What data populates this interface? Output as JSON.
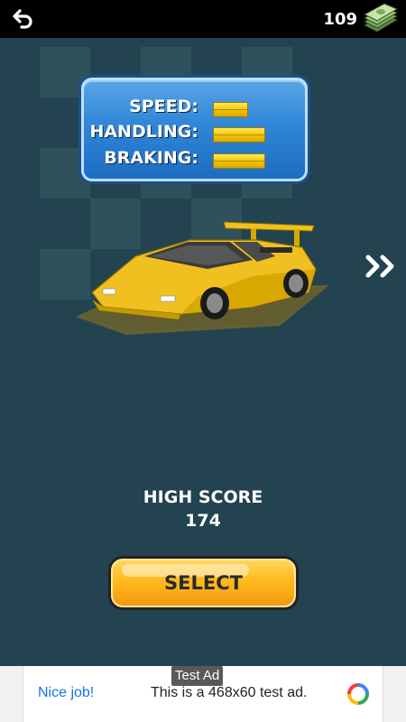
{
  "topbar": {
    "back_icon": "undo-arrow-icon",
    "money_count": "109",
    "cash_icon": "cash-stack-icon"
  },
  "stats": {
    "rows": [
      {
        "label": "SPEED:",
        "fill": 0.32
      },
      {
        "label": "HANDLING:",
        "fill": 0.48
      },
      {
        "label": "BRAKING:",
        "fill": 0.48
      }
    ],
    "bar_color": "#f2c400",
    "panel_color": "#2f86d8"
  },
  "car": {
    "color": "#f0c020",
    "icon": "yellow-sports-car"
  },
  "next": {
    "icon": "double-chevron-right-icon"
  },
  "high_score": {
    "label": "HIGH SCORE",
    "value": "174"
  },
  "select": {
    "label": "SELECT"
  },
  "ad": {
    "tag": "Test Ad",
    "nice": "Nice job!",
    "text": "This is a 468x60 test ad.",
    "logo_icon": "ad-network-logo-icon"
  }
}
